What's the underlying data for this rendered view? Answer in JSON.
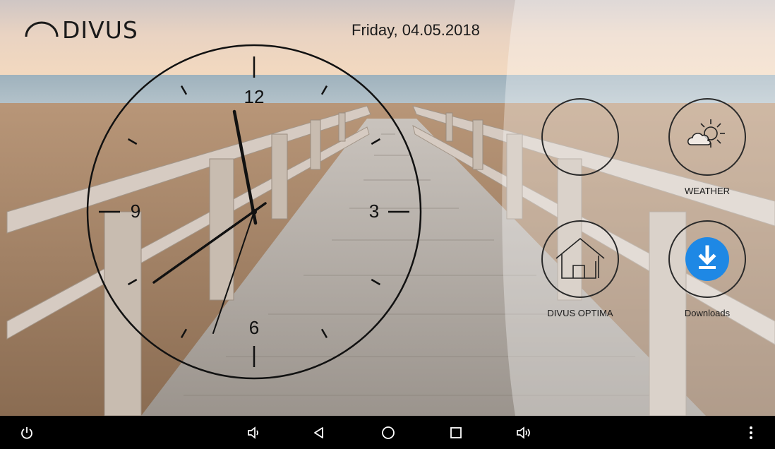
{
  "brand": {
    "name": "DIVUS"
  },
  "header": {
    "date": "Friday, 04.05.2018"
  },
  "clock": {
    "numerals": [
      "12",
      "3",
      "6",
      "9"
    ],
    "time": {
      "hours": 8,
      "minutes": 58,
      "seconds": 33
    }
  },
  "apps": [
    {
      "label": ""
    },
    {
      "label": "WEATHER"
    },
    {
      "label": "DIVUS OPTIMA"
    },
    {
      "label": "Downloads"
    }
  ],
  "colors": {
    "accent_blue": "#1e88e5",
    "navbar": "#000000"
  },
  "navbar": {
    "icons": [
      "power-icon",
      "volume-down-icon",
      "back-icon",
      "home-icon",
      "recents-icon",
      "volume-up-icon",
      "overflow-menu-icon"
    ]
  }
}
